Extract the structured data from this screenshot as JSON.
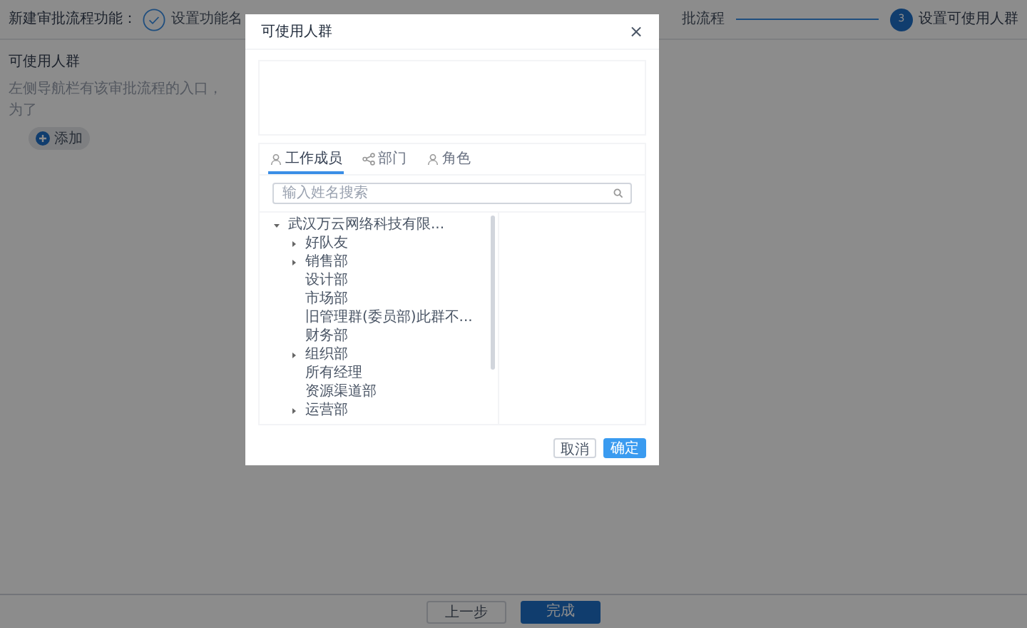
{
  "page": {
    "title": "新建审批流程功能：",
    "steps": [
      {
        "label": "设置功能名",
        "kind": "done"
      },
      {
        "label": "批流程",
        "kind": "covered"
      },
      {
        "number": "3",
        "label": "设置可使用人群",
        "kind": "active"
      }
    ],
    "section_label": "可使用人群",
    "section_hint": "左侧导航栏有该审批流程的入口，为了",
    "add_button": "添加",
    "footer_buttons": [
      {
        "label": "上一步",
        "kind": "secondary"
      },
      {
        "label": "完成",
        "kind": "primary"
      }
    ]
  },
  "dialog": {
    "title": "可使用人群",
    "close": "×",
    "tabs": [
      {
        "label": "工作成员",
        "selected": true
      },
      {
        "label": "部门",
        "selected": false
      },
      {
        "label": "角色",
        "selected": false
      }
    ],
    "search": {
      "placeholder": "输入姓名搜索"
    },
    "tree": [
      {
        "label": "武汉万云网络科技有限...",
        "kind": "group",
        "expanded": true,
        "children": [
          {
            "label": "好队友",
            "kind": "group",
            "expanded": false
          },
          {
            "label": "销售部",
            "kind": "group",
            "expanded": false
          },
          {
            "label": "设计部",
            "kind": "leaf"
          },
          {
            "label": "市场部",
            "kind": "leaf"
          },
          {
            "label": "旧管理群(委员部)此群不...",
            "kind": "leaf"
          },
          {
            "label": "财务部",
            "kind": "leaf"
          },
          {
            "label": "组织部",
            "kind": "group",
            "expanded": false
          },
          {
            "label": "所有经理",
            "kind": "leaf"
          },
          {
            "label": "资源渠道部",
            "kind": "leaf"
          },
          {
            "label": "运营部",
            "kind": "group",
            "expanded": false
          }
        ]
      }
    ],
    "buttons": [
      {
        "label": "取消",
        "kind": "secondary"
      },
      {
        "label": "确定",
        "kind": "primary"
      }
    ]
  }
}
